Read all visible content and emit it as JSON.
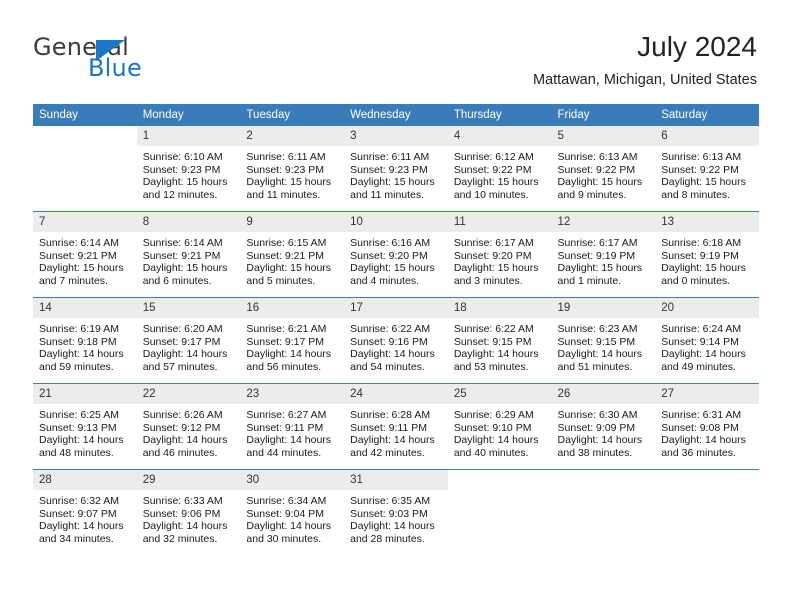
{
  "brand": {
    "name_top": "General",
    "name_bottom": "Blue",
    "triangle_color": "#1b77c4",
    "top_color": "#3c3c3c"
  },
  "header": {
    "title": "July 2024",
    "subtitle": "Mattawan, Michigan, United States"
  },
  "theme": {
    "header_blue": "#3a7cb9",
    "daynum_band": "#ececec",
    "separator": "#3a7cb9"
  },
  "weekday_headers": [
    "Sunday",
    "Monday",
    "Tuesday",
    "Wednesday",
    "Thursday",
    "Friday",
    "Saturday"
  ],
  "weeks": [
    {
      "days": [
        {
          "num": "",
          "sunrise": "",
          "sunset": "",
          "daylight_line1": "",
          "daylight_line2": "",
          "blank": true
        },
        {
          "num": "1",
          "sunrise": "Sunrise: 6:10 AM",
          "sunset": "Sunset: 9:23 PM",
          "daylight_line1": "Daylight: 15 hours",
          "daylight_line2": "and 12 minutes."
        },
        {
          "num": "2",
          "sunrise": "Sunrise: 6:11 AM",
          "sunset": "Sunset: 9:23 PM",
          "daylight_line1": "Daylight: 15 hours",
          "daylight_line2": "and 11 minutes."
        },
        {
          "num": "3",
          "sunrise": "Sunrise: 6:11 AM",
          "sunset": "Sunset: 9:23 PM",
          "daylight_line1": "Daylight: 15 hours",
          "daylight_line2": "and 11 minutes."
        },
        {
          "num": "4",
          "sunrise": "Sunrise: 6:12 AM",
          "sunset": "Sunset: 9:22 PM",
          "daylight_line1": "Daylight: 15 hours",
          "daylight_line2": "and 10 minutes."
        },
        {
          "num": "5",
          "sunrise": "Sunrise: 6:13 AM",
          "sunset": "Sunset: 9:22 PM",
          "daylight_line1": "Daylight: 15 hours",
          "daylight_line2": "and 9 minutes."
        },
        {
          "num": "6",
          "sunrise": "Sunrise: 6:13 AM",
          "sunset": "Sunset: 9:22 PM",
          "daylight_line1": "Daylight: 15 hours",
          "daylight_line2": "and 8 minutes."
        }
      ]
    },
    {
      "days": [
        {
          "num": "7",
          "sunrise": "Sunrise: 6:14 AM",
          "sunset": "Sunset: 9:21 PM",
          "daylight_line1": "Daylight: 15 hours",
          "daylight_line2": "and 7 minutes."
        },
        {
          "num": "8",
          "sunrise": "Sunrise: 6:14 AM",
          "sunset": "Sunset: 9:21 PM",
          "daylight_line1": "Daylight: 15 hours",
          "daylight_line2": "and 6 minutes."
        },
        {
          "num": "9",
          "sunrise": "Sunrise: 6:15 AM",
          "sunset": "Sunset: 9:21 PM",
          "daylight_line1": "Daylight: 15 hours",
          "daylight_line2": "and 5 minutes."
        },
        {
          "num": "10",
          "sunrise": "Sunrise: 6:16 AM",
          "sunset": "Sunset: 9:20 PM",
          "daylight_line1": "Daylight: 15 hours",
          "daylight_line2": "and 4 minutes."
        },
        {
          "num": "11",
          "sunrise": "Sunrise: 6:17 AM",
          "sunset": "Sunset: 9:20 PM",
          "daylight_line1": "Daylight: 15 hours",
          "daylight_line2": "and 3 minutes."
        },
        {
          "num": "12",
          "sunrise": "Sunrise: 6:17 AM",
          "sunset": "Sunset: 9:19 PM",
          "daylight_line1": "Daylight: 15 hours",
          "daylight_line2": "and 1 minute."
        },
        {
          "num": "13",
          "sunrise": "Sunrise: 6:18 AM",
          "sunset": "Sunset: 9:19 PM",
          "daylight_line1": "Daylight: 15 hours",
          "daylight_line2": "and 0 minutes."
        }
      ]
    },
    {
      "days": [
        {
          "num": "14",
          "sunrise": "Sunrise: 6:19 AM",
          "sunset": "Sunset: 9:18 PM",
          "daylight_line1": "Daylight: 14 hours",
          "daylight_line2": "and 59 minutes."
        },
        {
          "num": "15",
          "sunrise": "Sunrise: 6:20 AM",
          "sunset": "Sunset: 9:17 PM",
          "daylight_line1": "Daylight: 14 hours",
          "daylight_line2": "and 57 minutes."
        },
        {
          "num": "16",
          "sunrise": "Sunrise: 6:21 AM",
          "sunset": "Sunset: 9:17 PM",
          "daylight_line1": "Daylight: 14 hours",
          "daylight_line2": "and 56 minutes."
        },
        {
          "num": "17",
          "sunrise": "Sunrise: 6:22 AM",
          "sunset": "Sunset: 9:16 PM",
          "daylight_line1": "Daylight: 14 hours",
          "daylight_line2": "and 54 minutes."
        },
        {
          "num": "18",
          "sunrise": "Sunrise: 6:22 AM",
          "sunset": "Sunset: 9:15 PM",
          "daylight_line1": "Daylight: 14 hours",
          "daylight_line2": "and 53 minutes."
        },
        {
          "num": "19",
          "sunrise": "Sunrise: 6:23 AM",
          "sunset": "Sunset: 9:15 PM",
          "daylight_line1": "Daylight: 14 hours",
          "daylight_line2": "and 51 minutes."
        },
        {
          "num": "20",
          "sunrise": "Sunrise: 6:24 AM",
          "sunset": "Sunset: 9:14 PM",
          "daylight_line1": "Daylight: 14 hours",
          "daylight_line2": "and 49 minutes."
        }
      ]
    },
    {
      "days": [
        {
          "num": "21",
          "sunrise": "Sunrise: 6:25 AM",
          "sunset": "Sunset: 9:13 PM",
          "daylight_line1": "Daylight: 14 hours",
          "daylight_line2": "and 48 minutes."
        },
        {
          "num": "22",
          "sunrise": "Sunrise: 6:26 AM",
          "sunset": "Sunset: 9:12 PM",
          "daylight_line1": "Daylight: 14 hours",
          "daylight_line2": "and 46 minutes."
        },
        {
          "num": "23",
          "sunrise": "Sunrise: 6:27 AM",
          "sunset": "Sunset: 9:11 PM",
          "daylight_line1": "Daylight: 14 hours",
          "daylight_line2": "and 44 minutes."
        },
        {
          "num": "24",
          "sunrise": "Sunrise: 6:28 AM",
          "sunset": "Sunset: 9:11 PM",
          "daylight_line1": "Daylight: 14 hours",
          "daylight_line2": "and 42 minutes."
        },
        {
          "num": "25",
          "sunrise": "Sunrise: 6:29 AM",
          "sunset": "Sunset: 9:10 PM",
          "daylight_line1": "Daylight: 14 hours",
          "daylight_line2": "and 40 minutes."
        },
        {
          "num": "26",
          "sunrise": "Sunrise: 6:30 AM",
          "sunset": "Sunset: 9:09 PM",
          "daylight_line1": "Daylight: 14 hours",
          "daylight_line2": "and 38 minutes."
        },
        {
          "num": "27",
          "sunrise": "Sunrise: 6:31 AM",
          "sunset": "Sunset: 9:08 PM",
          "daylight_line1": "Daylight: 14 hours",
          "daylight_line2": "and 36 minutes."
        }
      ]
    },
    {
      "days": [
        {
          "num": "28",
          "sunrise": "Sunrise: 6:32 AM",
          "sunset": "Sunset: 9:07 PM",
          "daylight_line1": "Daylight: 14 hours",
          "daylight_line2": "and 34 minutes."
        },
        {
          "num": "29",
          "sunrise": "Sunrise: 6:33 AM",
          "sunset": "Sunset: 9:06 PM",
          "daylight_line1": "Daylight: 14 hours",
          "daylight_line2": "and 32 minutes."
        },
        {
          "num": "30",
          "sunrise": "Sunrise: 6:34 AM",
          "sunset": "Sunset: 9:04 PM",
          "daylight_line1": "Daylight: 14 hours",
          "daylight_line2": "and 30 minutes."
        },
        {
          "num": "31",
          "sunrise": "Sunrise: 6:35 AM",
          "sunset": "Sunset: 9:03 PM",
          "daylight_line1": "Daylight: 14 hours",
          "daylight_line2": "and 28 minutes."
        },
        {
          "num": "",
          "sunrise": "",
          "sunset": "",
          "daylight_line1": "",
          "daylight_line2": "",
          "blank": true
        },
        {
          "num": "",
          "sunrise": "",
          "sunset": "",
          "daylight_line1": "",
          "daylight_line2": "",
          "blank": true
        },
        {
          "num": "",
          "sunrise": "",
          "sunset": "",
          "daylight_line1": "",
          "daylight_line2": "",
          "blank": true
        }
      ]
    }
  ]
}
